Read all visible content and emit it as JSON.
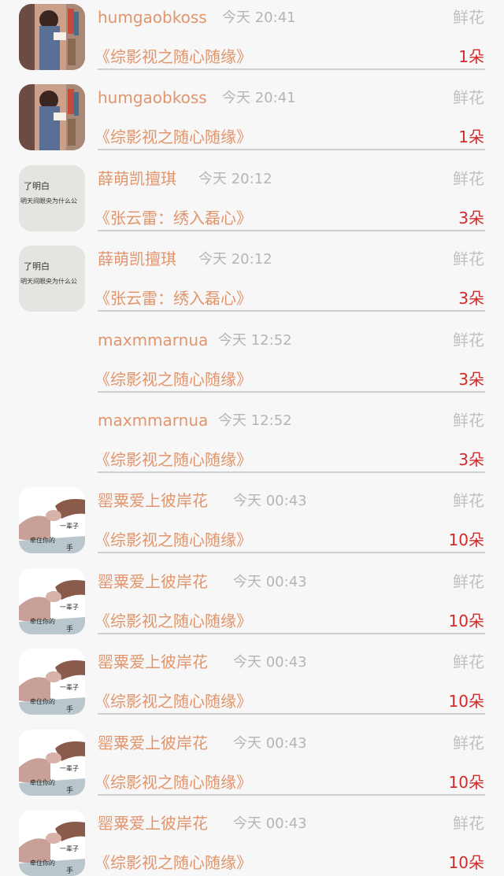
{
  "gift_kind": "鲜花",
  "rows": [
    {
      "user": "humgaobkoss",
      "time": "今天 20:41",
      "kind": "鲜花",
      "work": "《综影视之随心随缘》",
      "count": "1朵",
      "avatar": "girl-reading"
    },
    {
      "user": "humgaobkoss",
      "time": "今天 20:41",
      "kind": "鲜花",
      "work": "《综影视之随心随缘》",
      "count": "1朵",
      "avatar": "girl-reading"
    },
    {
      "user": "薛萌凯擅琪",
      "time": "今天 20:12",
      "kind": "鲜花",
      "work": "《张云雷：绣入磊心》",
      "count": "3朵",
      "avatar": "handwriting-note"
    },
    {
      "user": "薛萌凯擅琪",
      "time": "今天 20:12",
      "kind": "鲜花",
      "work": "《张云雷：绣入磊心》",
      "count": "3朵",
      "avatar": "handwriting-note"
    },
    {
      "user": "maxmmarnua",
      "time": "今天 12:52",
      "kind": "鲜花",
      "work": "《综影视之随心随缘》",
      "count": "3朵",
      "avatar": "none"
    },
    {
      "user": "maxmmarnua",
      "time": "今天 12:52",
      "kind": "鲜花",
      "work": "《综影视之随心随缘》",
      "count": "3朵",
      "avatar": "none"
    },
    {
      "user": "罂粟爱上彼岸花",
      "time": "今天 00:43",
      "kind": "鲜花",
      "work": "《综影视之随心随缘》",
      "count": "10朵",
      "avatar": "holding-hands"
    },
    {
      "user": "罂粟爱上彼岸花",
      "time": "今天 00:43",
      "kind": "鲜花",
      "work": "《综影视之随心随缘》",
      "count": "10朵",
      "avatar": "holding-hands"
    },
    {
      "user": "罂粟爱上彼岸花",
      "time": "今天 00:43",
      "kind": "鲜花",
      "work": "《综影视之随心随缘》",
      "count": "10朵",
      "avatar": "holding-hands"
    },
    {
      "user": "罂粟爱上彼岸花",
      "time": "今天 00:43",
      "kind": "鲜花",
      "work": "《综影视之随心随缘》",
      "count": "10朵",
      "avatar": "holding-hands"
    },
    {
      "user": "罂粟爱上彼岸花",
      "time": "今天 00:43",
      "kind": "鲜花",
      "work": "《综影视之随心随缘》",
      "count": "10朵",
      "avatar": "holding-hands"
    }
  ],
  "avatar_texts": {
    "handwriting": [
      "了明白",
      "明天间眼央为什么公"
    ],
    "hands": [
      "一辈子",
      "牵住你的",
      "手"
    ]
  },
  "colors": {
    "name": "#e1956c",
    "time": "#b5b5b5",
    "count": "#d02a2a",
    "background": "#f7f7f7",
    "divider": "#cfcfcf"
  }
}
